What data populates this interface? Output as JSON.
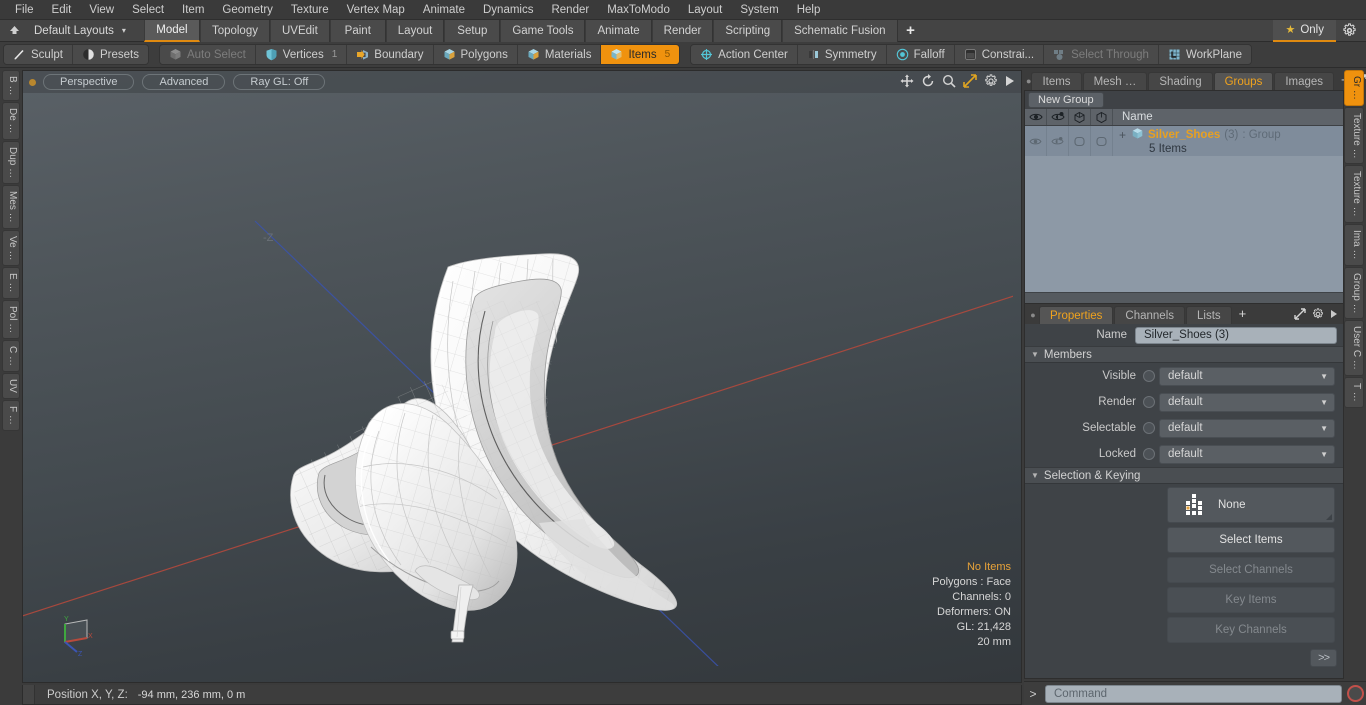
{
  "menubar": {
    "items": [
      "File",
      "Edit",
      "View",
      "Select",
      "Item",
      "Geometry",
      "Texture",
      "Vertex Map",
      "Animate",
      "Dynamics",
      "Render",
      "MaxToModo",
      "Layout",
      "System",
      "Help"
    ]
  },
  "layoutbar": {
    "layout_label": "Default Layouts",
    "caret": "▾",
    "tabs": [
      {
        "label": "Model",
        "active": true
      },
      {
        "label": "Topology",
        "active": false
      },
      {
        "label": "UVEdit",
        "active": false
      },
      {
        "label": "Paint",
        "active": false
      },
      {
        "label": "Layout",
        "active": false
      },
      {
        "label": "Setup",
        "active": false
      },
      {
        "label": "Game Tools",
        "active": false
      },
      {
        "label": "Animate",
        "active": false
      },
      {
        "label": "Render",
        "active": false
      },
      {
        "label": "Scripting",
        "active": false
      },
      {
        "label": "Schematic Fusion",
        "active": false
      }
    ],
    "add_label": "+",
    "only_label": "Only",
    "star_glyph": "★"
  },
  "toolbar": {
    "group1": [
      {
        "label": "Sculpt",
        "icon": "sculpt-brush-icon",
        "state": "normal"
      },
      {
        "label": "Presets",
        "icon": "presets-sphere-icon",
        "state": "normal"
      }
    ],
    "group2": [
      {
        "label": "Auto Select",
        "icon": "cube-grey-icon",
        "state": "dim"
      },
      {
        "label": "Vertices",
        "icon": "shield-icon",
        "state": "normal",
        "count": "1"
      },
      {
        "label": "Boundary",
        "icon": "boundary-arrow-icon",
        "state": "normal"
      },
      {
        "label": "Polygons",
        "icon": "cube-icon",
        "state": "normal"
      },
      {
        "label": "Materials",
        "icon": "cube-icon",
        "state": "normal"
      },
      {
        "label": "Items",
        "icon": "cube-icon",
        "state": "selected",
        "count": "5"
      }
    ],
    "group3": [
      {
        "label": "Action Center",
        "icon": "action-center-icon",
        "state": "normal"
      },
      {
        "label": "Symmetry",
        "icon": "symmetry-icon",
        "state": "normal"
      },
      {
        "label": "Falloff",
        "icon": "falloff-icon",
        "state": "normal"
      },
      {
        "label": "Constrai...",
        "icon": "constraint-icon",
        "state": "normal"
      },
      {
        "label": "Select Through",
        "icon": "select-through-icon",
        "state": "dim"
      },
      {
        "label": "WorkPlane",
        "icon": "workplane-icon",
        "state": "normal"
      }
    ]
  },
  "left_rail": {
    "tabs": [
      "B …",
      "De …",
      "Dup …",
      "Mes …",
      "Ve …",
      "E …",
      "Pol …",
      "C …",
      "UV",
      "F …"
    ]
  },
  "viewport": {
    "pills": [
      "Perspective",
      "Advanced",
      "Ray GL: Off"
    ],
    "icons": [
      "move-icon",
      "rotate-icon",
      "zoom-icon",
      "fit-icon",
      "gear-icon",
      "play-icon"
    ],
    "stats": {
      "selection": "No Items",
      "polygons": "Polygons : Face",
      "channels": "Channels: 0",
      "deformers": "Deformers: ON",
      "gl": "GL: 21,428",
      "scale": "20 mm"
    },
    "gizmo": {
      "x": "X",
      "y": "Y",
      "z": "Z",
      "neg_z": "-Z"
    }
  },
  "statusbar": {
    "label": "Position X, Y, Z:",
    "value": "-94 mm, 236 mm, 0 m"
  },
  "right_panel": {
    "tabs": [
      {
        "label": "Items",
        "active": false
      },
      {
        "label": "Mesh …",
        "active": false
      },
      {
        "label": "Shading",
        "active": false
      },
      {
        "label": "Groups",
        "active": true
      },
      {
        "label": "Images",
        "active": false
      }
    ],
    "tab_add": "+",
    "new_group_label": "New Group",
    "list_columns": [
      "eye-icon",
      "render-icon",
      "wire-icon",
      "shade-icon"
    ],
    "list_name_header": "Name",
    "rows": [
      {
        "expand": "+",
        "name": "Silver_Shoes",
        "count": "(3)",
        "type": ": Group",
        "subtitle": "5 Items"
      }
    ]
  },
  "properties": {
    "tabs": [
      {
        "label": "Properties",
        "active": true
      },
      {
        "label": "Channels",
        "active": false
      },
      {
        "label": "Lists",
        "active": false
      }
    ],
    "tab_add": "+",
    "name_label": "Name",
    "name_value": "Silver_Shoes (3)",
    "members_section": "Members",
    "member_rows": [
      {
        "label": "Visible",
        "value": "default"
      },
      {
        "label": "Render",
        "value": "default"
      },
      {
        "label": "Selectable",
        "value": "default"
      },
      {
        "label": "Locked",
        "value": "default"
      }
    ],
    "selection_section": "Selection & Keying",
    "buttons": [
      {
        "label": "None",
        "state": "normal",
        "icon": "pixel-grid-icon"
      },
      {
        "label": "Select Items",
        "state": "normal"
      },
      {
        "label": "Select Channels",
        "state": "disabled"
      },
      {
        "label": "Key Items",
        "state": "disabled"
      },
      {
        "label": "Key Channels",
        "state": "disabled"
      }
    ],
    "goto_label": ">>"
  },
  "right_rail": {
    "tabs": [
      {
        "label": "Gr …",
        "active": true
      },
      {
        "label": "Texture …",
        "active": false
      },
      {
        "label": "Texture …",
        "active": false
      },
      {
        "label": "Ima …",
        "active": false
      },
      {
        "label": "Group …",
        "active": false
      },
      {
        "label": "User C …",
        "active": false
      },
      {
        "label": "T …",
        "active": false
      }
    ]
  },
  "command_bar": {
    "prompt": ">",
    "placeholder": "Command",
    "record_icon": "record-circle-icon"
  },
  "colors": {
    "accent": "#f0920e",
    "accent_text": "#e8a021",
    "panel_bg": "#3b3b3b",
    "list_bg": "#8d99a6",
    "axis_x": "#b84a3c",
    "axis_z": "#3b55b4",
    "axis_y": "#3fa83f"
  }
}
